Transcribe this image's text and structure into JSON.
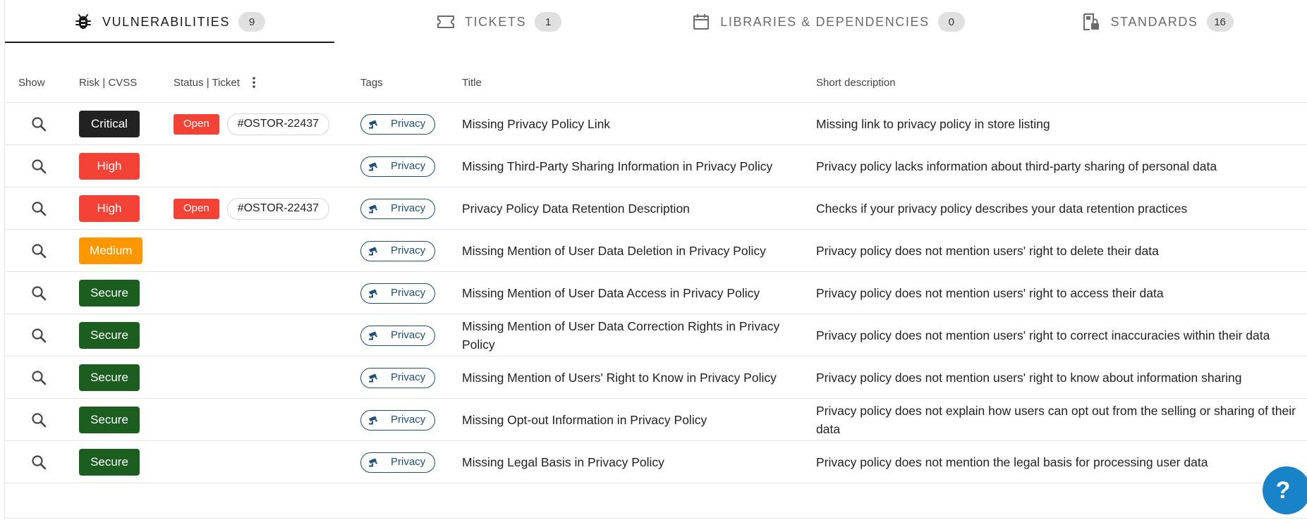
{
  "tabs": [
    {
      "label": "VULNERABILITIES",
      "count": "9",
      "icon": "bug-icon"
    },
    {
      "label": "TICKETS",
      "count": "1",
      "icon": "ticket-icon"
    },
    {
      "label": "LIBRARIES & DEPENDENCIES",
      "count": "0",
      "icon": "calendar-icon"
    },
    {
      "label": "STANDARDS",
      "count": "16",
      "icon": "lock-document-icon"
    }
  ],
  "table": {
    "headers": {
      "show": "Show",
      "risk": "Risk | CVSS",
      "status": "Status | Ticket",
      "tags": "Tags",
      "title": "Title",
      "description": "Short description"
    },
    "rows": [
      {
        "risk": "Critical",
        "risk_color": "#222222",
        "status": "Open",
        "ticket": "#OSTOR-22437",
        "tag": "Privacy",
        "title": "Missing Privacy Policy Link",
        "description": "Missing link to privacy policy in store listing"
      },
      {
        "risk": "High",
        "risk_color": "#f44336",
        "status": "",
        "ticket": "",
        "tag": "Privacy",
        "title": "Missing Third-Party Sharing Information in Privacy Policy",
        "description": "Privacy policy lacks information about third-party sharing of personal data"
      },
      {
        "risk": "High",
        "risk_color": "#f44336",
        "status": "Open",
        "ticket": "#OSTOR-22437",
        "tag": "Privacy",
        "title": "Privacy Policy Data Retention Description",
        "description": "Checks if your privacy policy describes your data retention practices"
      },
      {
        "risk": "Medium",
        "risk_color": "#ff9800",
        "status": "",
        "ticket": "",
        "tag": "Privacy",
        "title": "Missing Mention of User Data Deletion in Privacy Policy",
        "description": "Privacy policy does not mention users' right to delete their data"
      },
      {
        "risk": "Secure",
        "risk_color": "#1b5e20",
        "status": "",
        "ticket": "",
        "tag": "Privacy",
        "title": "Missing Mention of User Data Access in Privacy Policy",
        "description": "Privacy policy does not mention users' right to access their data"
      },
      {
        "risk": "Secure",
        "risk_color": "#1b5e20",
        "status": "",
        "ticket": "",
        "tag": "Privacy",
        "title": "Missing Mention of User Data Correction Rights in Privacy Policy",
        "description": "Privacy policy does not mention users' right to correct inaccuracies within their data"
      },
      {
        "risk": "Secure",
        "risk_color": "#1b5e20",
        "status": "",
        "ticket": "",
        "tag": "Privacy",
        "title": "Missing Mention of Users' Right to Know in Privacy Policy",
        "description": "Privacy policy does not mention users' right to know about information sharing"
      },
      {
        "risk": "Secure",
        "risk_color": "#1b5e20",
        "status": "",
        "ticket": "",
        "tag": "Privacy",
        "title": "Missing Opt-out Information in Privacy Policy",
        "description": "Privacy policy does not explain how users can opt out from the selling or sharing of their data"
      },
      {
        "risk": "Secure",
        "risk_color": "#1b5e20",
        "status": "",
        "ticket": "",
        "tag": "Privacy",
        "title": "Missing Legal Basis in Privacy Policy",
        "description": "Privacy policy does not mention the legal basis for processing user data"
      }
    ]
  },
  "help": {
    "label": "?"
  }
}
